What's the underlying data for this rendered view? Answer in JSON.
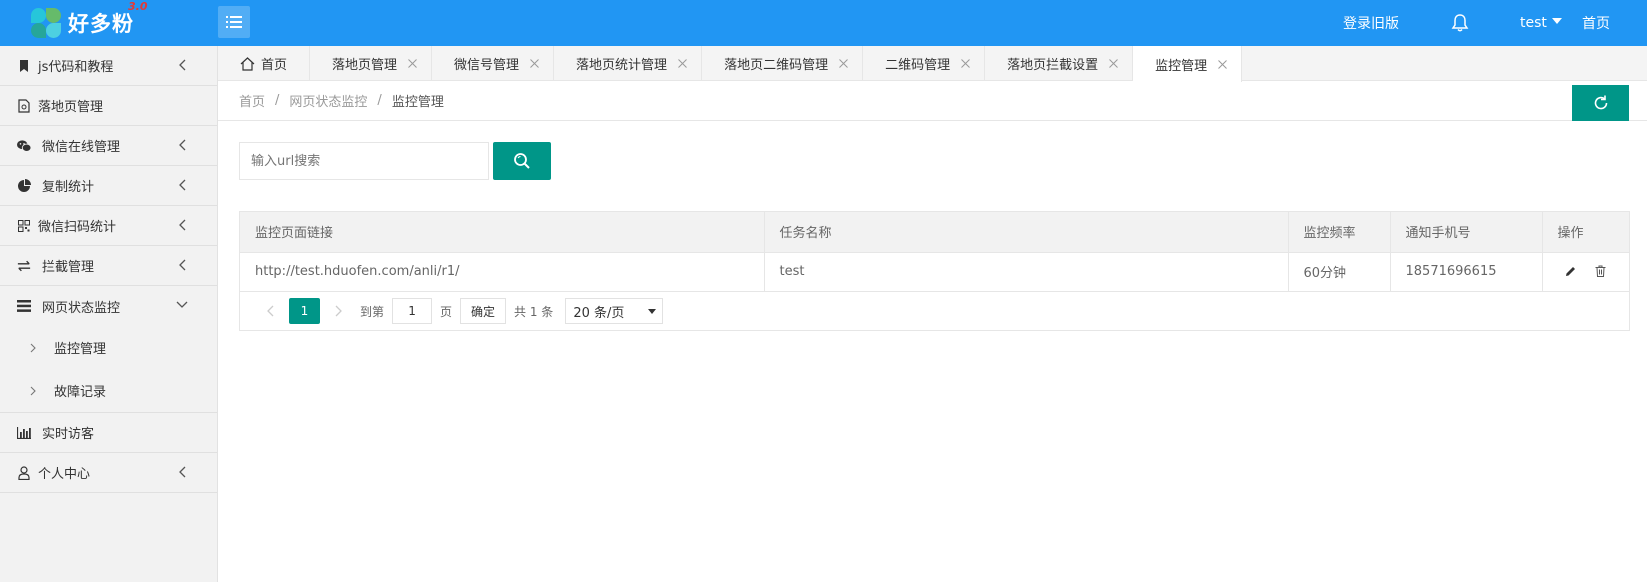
{
  "header": {
    "logo_text": "好多粉",
    "logo_version": "3.0",
    "old_version_link": "登录旧版",
    "user_name": "test",
    "home_link": "首页",
    "bg_color": "#2196f3"
  },
  "sidebar": {
    "items": [
      {
        "label": "js代码和教程",
        "icon": "bookmark-icon"
      },
      {
        "label": "落地页管理",
        "icon": "document-icon"
      },
      {
        "label": "微信在线管理",
        "icon": "wechat-icon"
      },
      {
        "label": "复制统计",
        "icon": "pie-chart-icon"
      },
      {
        "label": "微信扫码统计",
        "icon": "qrcode-icon"
      },
      {
        "label": "拦截管理",
        "icon": "transfer-icon"
      },
      {
        "label": "网页状态监控",
        "icon": "list-icon"
      },
      {
        "label": "实时访客",
        "icon": "bar-chart-icon"
      },
      {
        "label": "个人中心",
        "icon": "user-icon"
      }
    ],
    "submenu": [
      {
        "label": "监控管理"
      },
      {
        "label": "故障记录"
      }
    ]
  },
  "tabs": [
    {
      "label": "首页"
    },
    {
      "label": "落地页管理"
    },
    {
      "label": "微信号管理"
    },
    {
      "label": "落地页统计管理"
    },
    {
      "label": "落地页二维码管理"
    },
    {
      "label": "二维码管理"
    },
    {
      "label": "落地页拦截设置"
    },
    {
      "label": "监控管理"
    }
  ],
  "breadcrumb": {
    "items": [
      "首页",
      "网页状态监控",
      "监控管理"
    ],
    "separator": "/"
  },
  "search": {
    "placeholder": "输入url搜索",
    "value": ""
  },
  "table": {
    "columns": [
      "监控页面链接",
      "任务名称",
      "监控频率",
      "通知手机号",
      "操作"
    ],
    "rows": [
      {
        "url": "http://test.hduofen.com/anli/r1/",
        "task": "test",
        "frequency": "60分钟",
        "phone": "18571696615"
      }
    ]
  },
  "pagination": {
    "current_page": "1",
    "goto_label": "到第",
    "goto_value": "1",
    "page_unit": "页",
    "confirm_label": "确定",
    "total_label": "共 1 条",
    "page_size": "20 条/页"
  },
  "colors": {
    "primary_green": "#009688",
    "header_blue": "#2196f3"
  }
}
